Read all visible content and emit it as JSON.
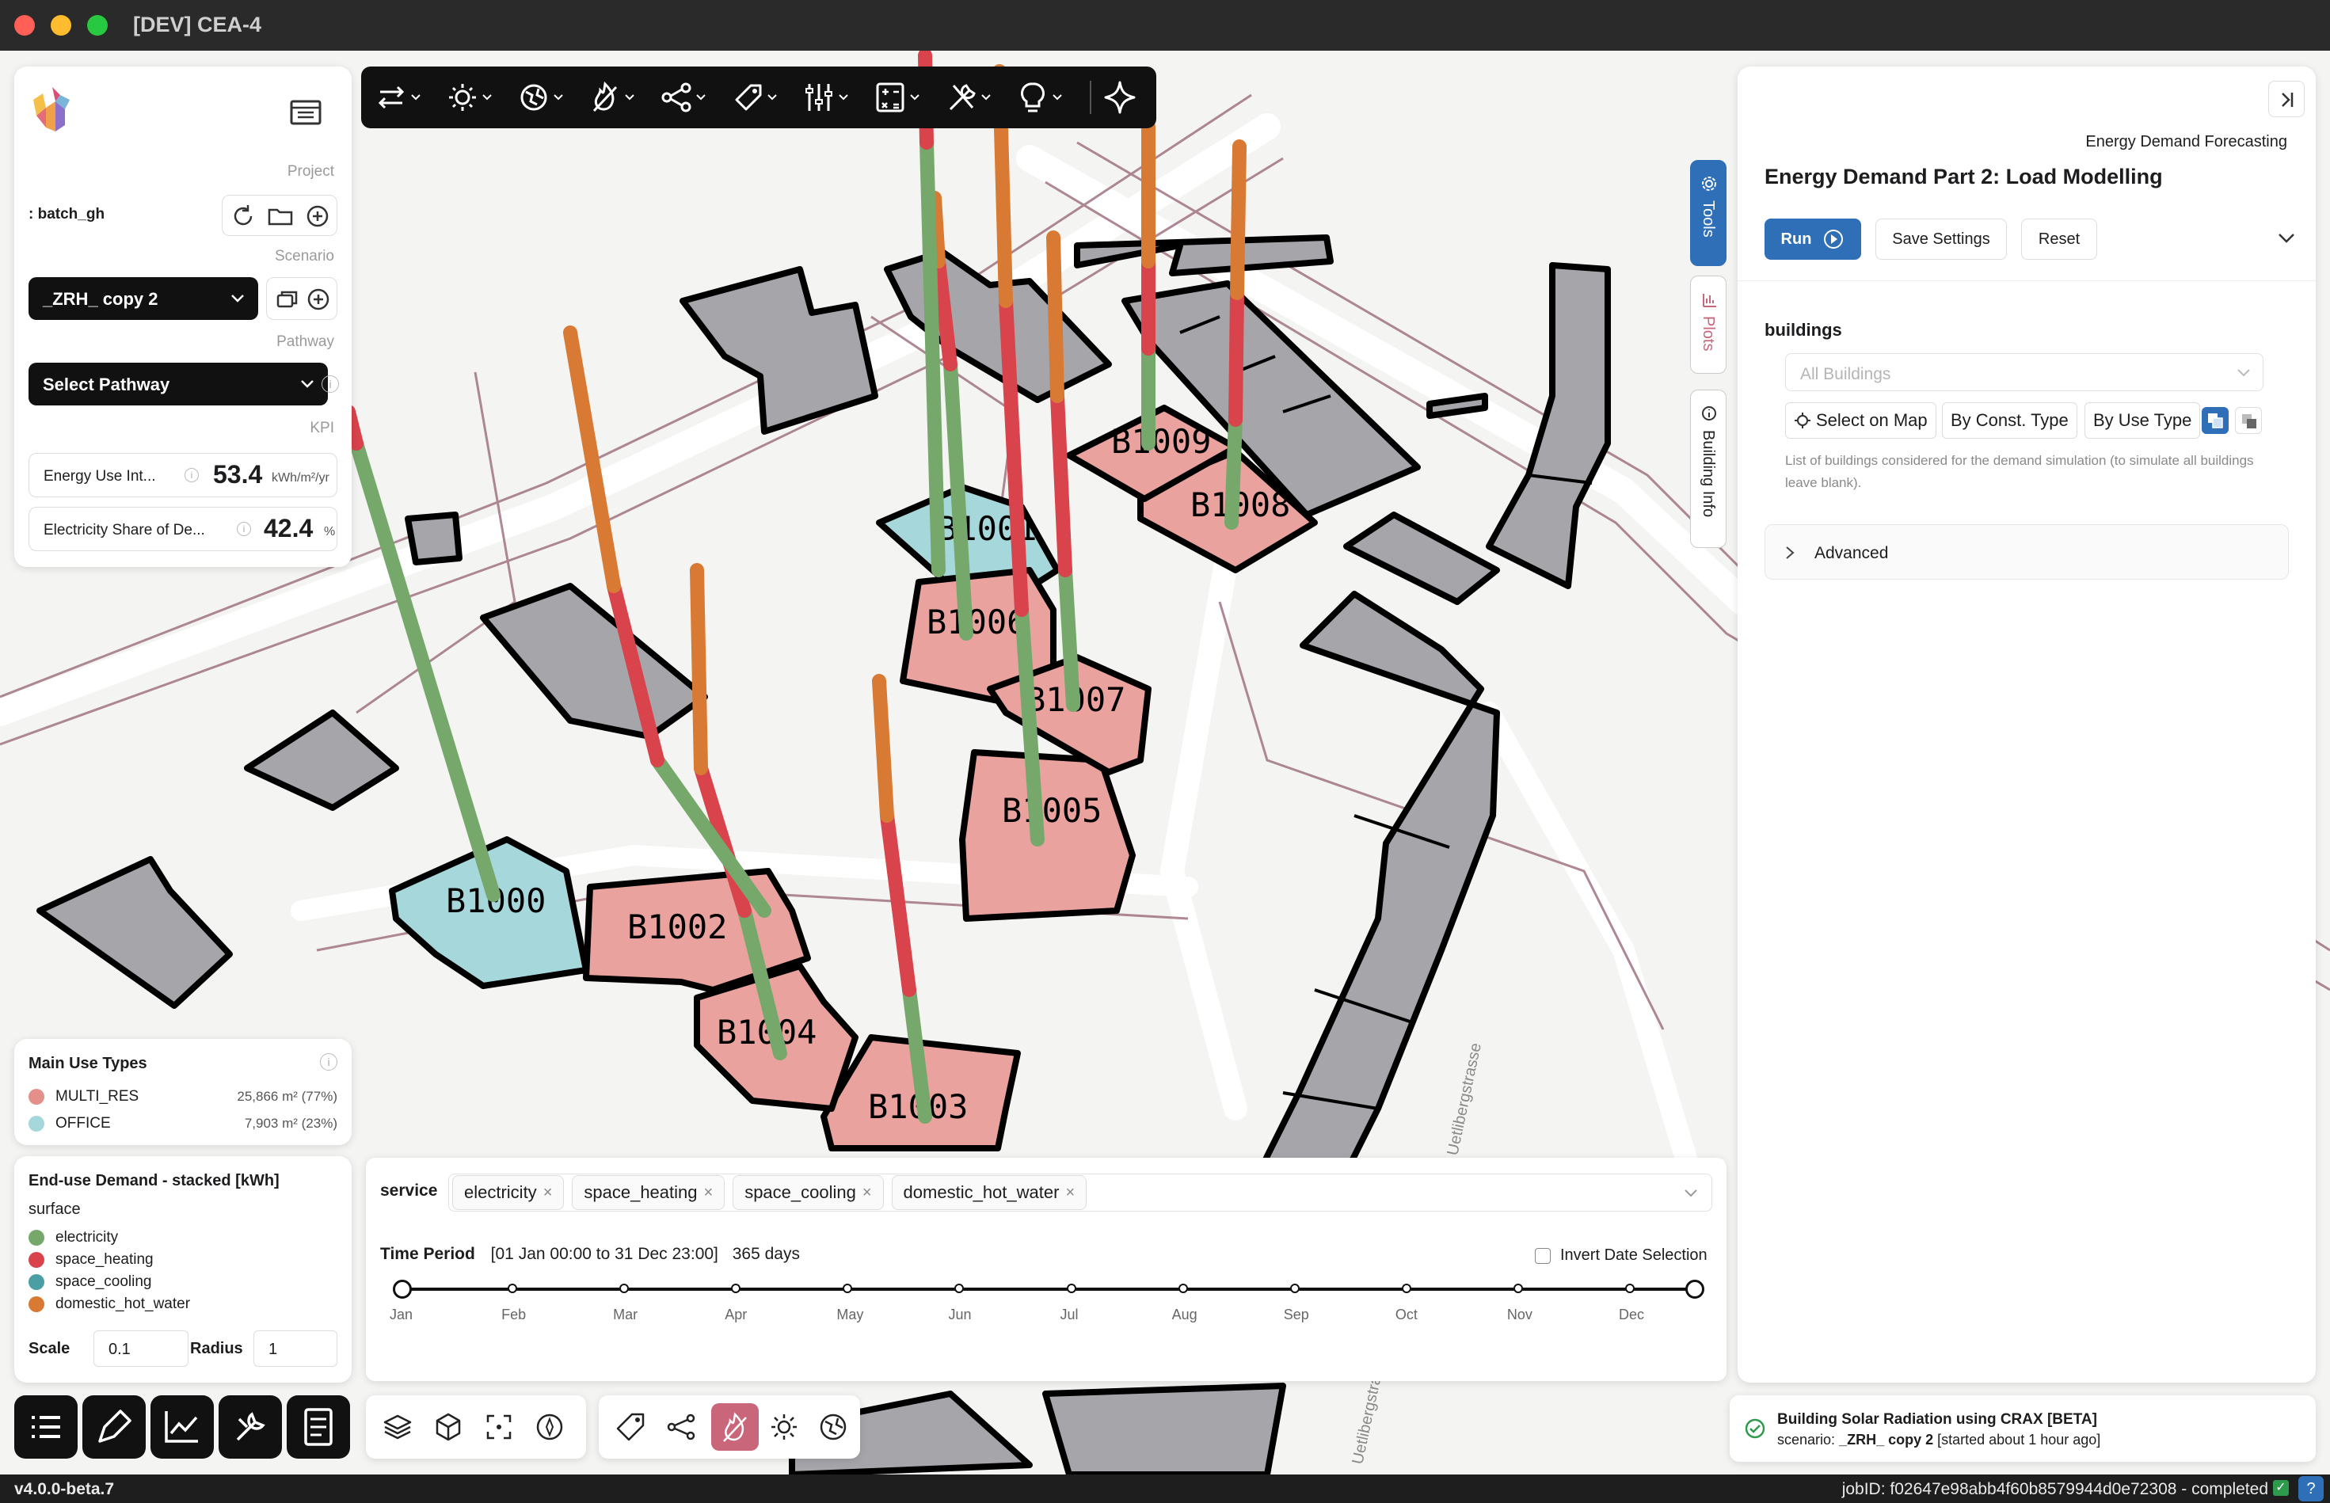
{
  "window": {
    "title": "[DEV] CEA-4"
  },
  "left_panel": {
    "project_label": "Project",
    "project_name": ": batch_gh",
    "scenario_label": "Scenario",
    "scenario_name": "_ZRH_ copy 2",
    "pathway_label": "Pathway",
    "pathway_select": "Select Pathway",
    "kpi_label": "KPI",
    "kpis": [
      {
        "label": "Energy Use Int...",
        "value": "53.4",
        "unit": "kWh/m²/yr"
      },
      {
        "label": "Electricity Share of De...",
        "value": "42.4",
        "unit": "%"
      }
    ]
  },
  "use_types": {
    "title": "Main Use Types",
    "items": [
      {
        "name": "MULTI_RES",
        "value": "25,866 m² (77%)",
        "color": "#e58f8b"
      },
      {
        "name": "OFFICE",
        "value": "7,903 m² (23%)",
        "color": "#a6d7db"
      }
    ]
  },
  "end_use": {
    "title": "End-use Demand - stacked [kWh]",
    "subtitle": "surface",
    "items": [
      {
        "name": "electricity",
        "color": "#76a86c"
      },
      {
        "name": "space_heating",
        "color": "#d8434c"
      },
      {
        "name": "space_cooling",
        "color": "#4b9ea3"
      },
      {
        "name": "domestic_hot_water",
        "color": "#d97a34"
      }
    ],
    "scale_label": "Scale",
    "scale_value": "0.1",
    "radius_label": "Radius",
    "radius_value": "1"
  },
  "timeline": {
    "service_label": "service",
    "services": [
      "electricity",
      "space_heating",
      "space_cooling",
      "domestic_hot_water"
    ],
    "time_period_label": "Time Period",
    "time_period_range": "[01 Jan 00:00 to 31 Dec 23:00]",
    "time_period_days": "365 days",
    "invert_label": "Invert Date Selection",
    "months": [
      "Jan",
      "Feb",
      "Mar",
      "Apr",
      "May",
      "Jun",
      "Jul",
      "Aug",
      "Sep",
      "Oct",
      "Nov",
      "Dec"
    ]
  },
  "right_panel": {
    "category": "Energy Demand Forecasting",
    "title": "Energy Demand Part 2: Load Modelling",
    "run_label": "Run",
    "save_label": "Save Settings",
    "reset_label": "Reset",
    "buildings_label": "buildings",
    "buildings_placeholder": "All Buildings",
    "select_on_map": "Select on Map",
    "by_const_type": "By Const. Type",
    "by_use_type": "By Use Type",
    "help": "List of buildings considered for the demand simulation (to simulate all buildings leave blank).",
    "advanced": "Advanced"
  },
  "side_tabs": [
    "Tools",
    "Plots",
    "Building Info"
  ],
  "job": {
    "title": "Building Solar Radiation using CRAX [BETA]",
    "scenario_prefix": "scenario:",
    "scenario_name": "_ZRH_ copy 2",
    "started": "[started about 1 hour ago]"
  },
  "status": {
    "version": "v4.0.0-beta.7",
    "job_id": "jobID: f02647e98abb4f60b8579944d0e72308 - completed"
  },
  "buildings": [
    "B1000",
    "B1001",
    "B1002",
    "B1003",
    "B1004",
    "B1005",
    "B1006",
    "B1007",
    "B1008",
    "B1009"
  ],
  "street_labels": [
    "Uetlibergstrasse",
    "Uetlibergstras"
  ]
}
